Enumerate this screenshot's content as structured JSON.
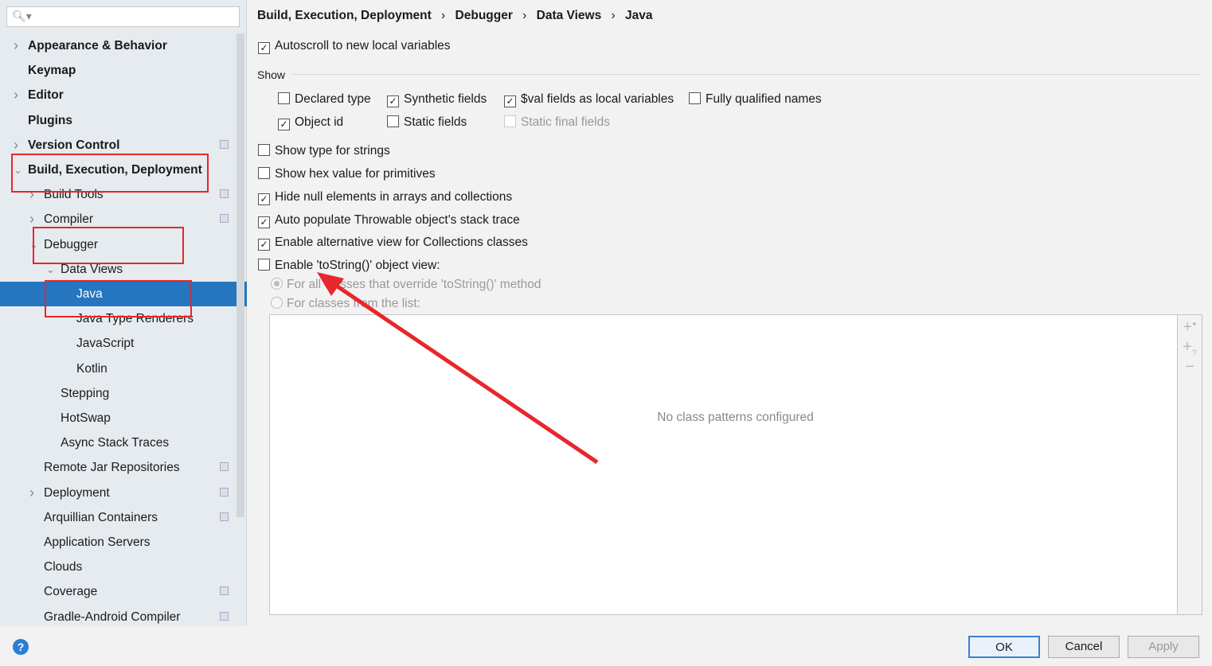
{
  "search": {
    "icon": "search-icon",
    "value": ""
  },
  "sidebar": {
    "items": [
      {
        "label": "Appearance & Behavior",
        "level": 0,
        "arrow": "right",
        "bold": true
      },
      {
        "label": "Keymap",
        "level": 0,
        "bold": true
      },
      {
        "label": "Editor",
        "level": 0,
        "arrow": "right",
        "bold": true
      },
      {
        "label": "Plugins",
        "level": 0,
        "bold": true
      },
      {
        "label": "Version Control",
        "level": 0,
        "arrow": "right",
        "bold": true,
        "copy": true
      },
      {
        "label": "Build, Execution, Deployment",
        "level": 0,
        "arrow": "down",
        "bold": true
      },
      {
        "label": "Build Tools",
        "level": 1,
        "arrow": "right",
        "copy": true
      },
      {
        "label": "Compiler",
        "level": 1,
        "arrow": "right",
        "copy": true
      },
      {
        "label": "Debugger",
        "level": 1,
        "arrow": "down"
      },
      {
        "label": "Data Views",
        "level": 2,
        "arrow": "down"
      },
      {
        "label": "Java",
        "level": 3,
        "selected": true
      },
      {
        "label": "Java Type Renderers",
        "level": 3
      },
      {
        "label": "JavaScript",
        "level": 3
      },
      {
        "label": "Kotlin",
        "level": 3
      },
      {
        "label": "Stepping",
        "level": 2
      },
      {
        "label": "HotSwap",
        "level": 2
      },
      {
        "label": "Async Stack Traces",
        "level": 2
      },
      {
        "label": "Remote Jar Repositories",
        "level": 1,
        "copy": true
      },
      {
        "label": "Deployment",
        "level": 1,
        "arrow": "right",
        "copy": true
      },
      {
        "label": "Arquillian Containers",
        "level": 1,
        "copy": true
      },
      {
        "label": "Application Servers",
        "level": 1
      },
      {
        "label": "Clouds",
        "level": 1
      },
      {
        "label": "Coverage",
        "level": 1,
        "copy": true
      },
      {
        "label": "Gradle-Android Compiler",
        "level": 1,
        "copy": true
      }
    ]
  },
  "breadcrumb": [
    "Build, Execution, Deployment",
    "Debugger",
    "Data Views",
    "Java"
  ],
  "autoscroll": {
    "label": "Autoscroll to new local variables",
    "checked": true
  },
  "show_label": "Show",
  "show_options": [
    {
      "label": "Declared type",
      "checked": false
    },
    {
      "label": "Synthetic fields",
      "checked": true
    },
    {
      "label": "$val fields as local variables",
      "checked": true
    },
    {
      "label": "Fully qualified names",
      "checked": false
    },
    {
      "label": "Object id",
      "checked": true
    },
    {
      "label": "Static fields",
      "checked": false
    },
    {
      "label": "Static final fields",
      "checked": false,
      "disabled": true
    }
  ],
  "options": [
    {
      "label": "Show type for strings",
      "checked": false
    },
    {
      "label": "Show hex value for primitives",
      "checked": false
    },
    {
      "label": "Hide null elements in arrays and collections",
      "checked": true
    },
    {
      "label": "Auto populate Throwable object's stack trace",
      "checked": true
    },
    {
      "label": "Enable alternative view for Collections classes",
      "checked": true
    },
    {
      "label": "Enable 'toString()' object view:",
      "checked": false
    }
  ],
  "radios": [
    {
      "label": "For all classes that override 'toString()' method",
      "selected": true
    },
    {
      "label": "For classes from the list:",
      "selected": false
    }
  ],
  "list": {
    "empty_text": "No class patterns configured",
    "tools": [
      "add-class-icon",
      "add-pattern-icon",
      "remove-icon"
    ]
  },
  "buttons": {
    "ok": "OK",
    "cancel": "Cancel",
    "apply": "Apply",
    "help": "?"
  },
  "colors": {
    "selection": "#2675bf",
    "annotation": "#e8262d"
  }
}
